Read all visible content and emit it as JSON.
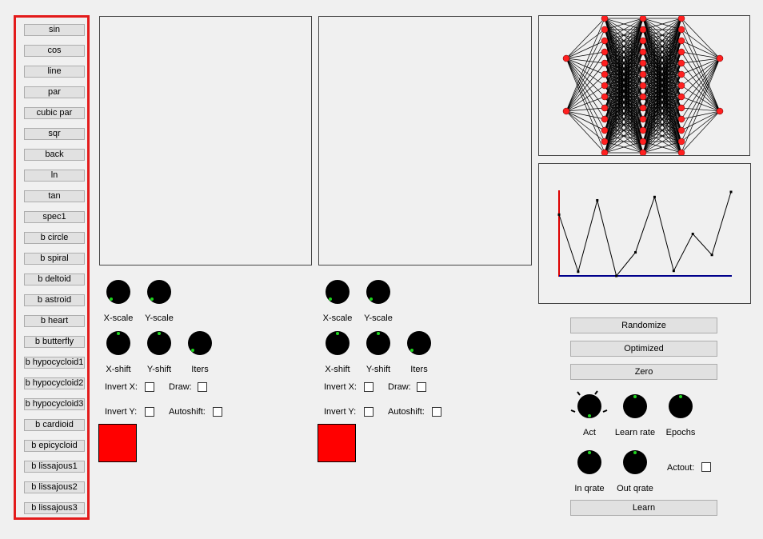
{
  "sidebar": {
    "buttons": [
      "sin",
      "cos",
      "line",
      "par",
      "cubic par",
      "sqr",
      "back",
      "ln",
      "tan",
      "spec1",
      "b  circle",
      "b  spiral",
      "b  deltoid",
      "b  astroid",
      "b  heart",
      "b  butterfly",
      "b  hypocycloid1",
      "b  hypocycloid2",
      "b  hypocycloid3",
      "b  cardioid",
      "b  epicycloid",
      "b  lissajous1",
      "b  lissajous2",
      "b  lissajous3"
    ]
  },
  "left_controls": {
    "xscale": "X-scale",
    "yscale": "Y-scale",
    "xshift": "X-shift",
    "yshift": "Y-shift",
    "iters": "Iters",
    "invert_x": "Invert X:",
    "draw": "Draw:",
    "invert_y": "Invert Y:",
    "autoshift": "Autoshift:",
    "color": "#ff0000"
  },
  "right_controls": {
    "xscale": "X-scale",
    "yscale": "Y-scale",
    "xshift": "X-shift",
    "yshift": "Y-shift",
    "iters": "Iters",
    "invert_x": "Invert X:",
    "draw": "Draw:",
    "invert_y": "Invert Y:",
    "autoshift": "Autoshift:",
    "color": "#ff0000"
  },
  "network": {
    "layers": [
      2,
      13,
      13,
      13,
      2
    ],
    "node_color": "#ff2020"
  },
  "error_chart": {
    "values": [
      0.73,
      0.05,
      0.9,
      0.0,
      0.28,
      0.94,
      0.06,
      0.5,
      0.25,
      1.0
    ]
  },
  "training": {
    "randomize": "Randomize",
    "optimized": "Optimized",
    "zero": "Zero",
    "act": "Act",
    "learn_rate": "Learn rate",
    "epochs": "Epochs",
    "actout": "Actout:",
    "in_qrate": "In qrate",
    "out_qrate": "Out qrate",
    "learn": "Learn"
  }
}
